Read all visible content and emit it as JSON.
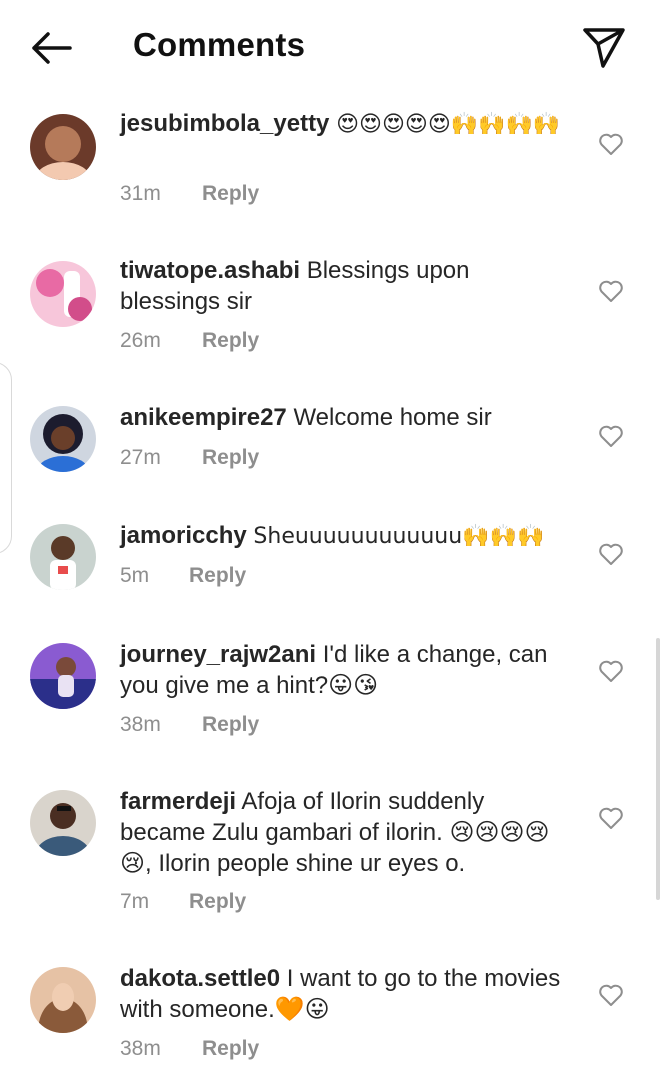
{
  "header": {
    "title": "Comments",
    "back_icon": "arrow-left-icon",
    "share_icon": "paper-plane-icon"
  },
  "comments": [
    {
      "username": "jesubimbola_yetty",
      "text": "😍😍😍😍😍🙌🙌🙌🙌",
      "time": "31m",
      "reply": "Reply",
      "avatar_colors": [
        "#6b3a2a",
        "#f3c9b0"
      ]
    },
    {
      "username": "tiwatope.ashabi",
      "text": "Blessings upon blessings sir",
      "time": "26m",
      "reply": "Reply",
      "avatar_colors": [
        "#e86aa4",
        "#f7c6da"
      ]
    },
    {
      "username": "anikeempire27",
      "text": "Welcome home sir",
      "time": "27m",
      "reply": "Reply",
      "avatar_colors": [
        "#1c1c2e",
        "#2b6fd6"
      ]
    },
    {
      "username": "jamoricchy",
      "text": "Sheuuuuuuuuuuuu🙌🙌🙌",
      "time": "5m",
      "reply": "Reply",
      "avatar_colors": [
        "#c9d3cf",
        "#e84c4c"
      ]
    },
    {
      "username": "journey_rajw2ani",
      "text": "I'd like a change, can you give me a hint?😛😘",
      "time": "38m",
      "reply": "Reply",
      "avatar_colors": [
        "#2b2f8a",
        "#8a5bd1"
      ]
    },
    {
      "username": "farmerdeji",
      "text": "Afoja of Ilorin suddenly became Zulu gambari of ilorin. 😢😢😢😢😢, Ilorin people shine ur eyes o.",
      "time": "7m",
      "reply": "Reply",
      "avatar_colors": [
        "#3a5a7a",
        "#d9d4cc"
      ]
    },
    {
      "username": "dakota.settle0",
      "text": "I want to go to the movies with someone.🧡😛",
      "time": "38m",
      "reply": "Reply",
      "avatar_colors": [
        "#8a5a3a",
        "#e6c2a5"
      ]
    }
  ],
  "like_icon": "heart-outline-icon",
  "colors": {
    "text": "#262626",
    "muted": "#8e8e8e",
    "background": "#ffffff"
  }
}
